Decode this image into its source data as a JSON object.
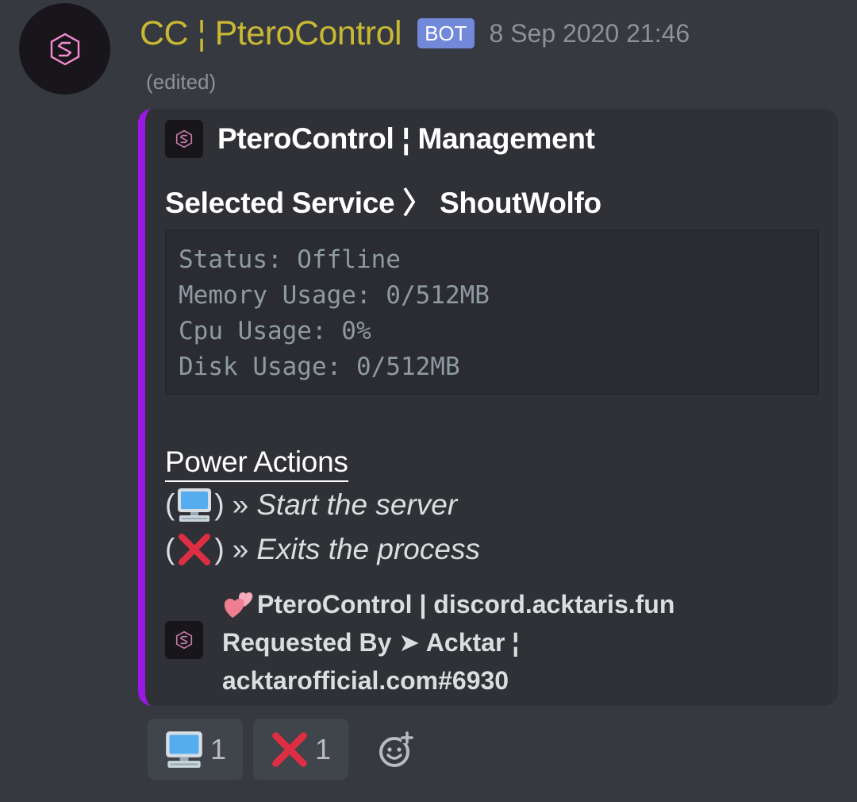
{
  "message": {
    "username": "CC ¦ PteroControl",
    "bot_tag": "BOT",
    "timestamp": "8 Sep 2020 21:46",
    "edited": "(edited)"
  },
  "embed": {
    "accent_color": "#9a17e6",
    "author_name": "PteroControl ¦ Management",
    "title": "Selected Service 〉 ShoutWolfo",
    "code_lines": [
      "Status: Offline",
      "Memory Usage: 0/512MB",
      "Cpu Usage: 0%",
      "Disk Usage: 0/512MB"
    ],
    "power_heading": "Power Actions",
    "actions": [
      {
        "icon": "computer-icon",
        "open": "(",
        "close": ")",
        "sep": "»",
        "desc": "Start the server"
      },
      {
        "icon": "cross-mark-icon",
        "open": "(",
        "close": ")",
        "sep": "»",
        "desc": "Exits the process"
      }
    ],
    "footer": {
      "emoji": "two-hearts-icon",
      "line1": "PteroControl | discord.acktaris.fun",
      "line2": "Requested By ➤ Acktar ¦",
      "line3": "acktarofficial.com#6930"
    }
  },
  "reactions": [
    {
      "icon": "computer-icon",
      "count": "1"
    },
    {
      "icon": "cross-mark-icon",
      "count": "1"
    }
  ],
  "colors": {
    "background": "#36393f",
    "embed_bg": "#2f3136",
    "username": "#c9b834",
    "bot_tag": "#7289da",
    "reaction_bg": "#40444b"
  }
}
